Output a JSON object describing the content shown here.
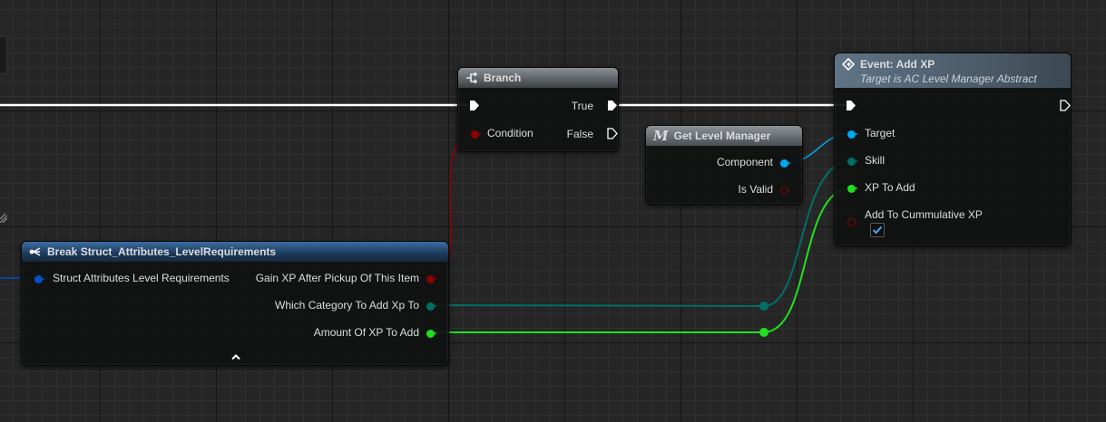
{
  "branch_node": {
    "title": "Branch",
    "condition_label": "Condition",
    "true_label": "True",
    "false_label": "False"
  },
  "get_level_manager_node": {
    "icon_letter": "M",
    "title": "Get Level Manager",
    "component_label": "Component",
    "is_valid_label": "Is Valid"
  },
  "event_node": {
    "title": "Event: Add XP",
    "subtitle": "Target is AC Level Manager Abstract",
    "target_label": "Target",
    "skill_label": "Skill",
    "xp_to_add_label": "XP To Add",
    "cumulative_label": "Add To Cummulative XP",
    "cumulative_checked": true
  },
  "break_node": {
    "title": "Break Struct_Attributes_LevelRequirements",
    "struct_input_label": "Struct Attributes Level Requirements",
    "gain_xp_label": "Gain XP After Pickup Of This Item",
    "category_label": "Which Category To Add Xp To",
    "amount_label": "Amount Of XP To Add",
    "collapse_icon": "chevron-up-icon"
  },
  "colors": {
    "bool_pin": "#8c0000",
    "object_pin": "#00a8f4",
    "byte_pin": "#006f65",
    "int_pin": "#1fe01f",
    "struct_pin": "#0050c8",
    "exec_wire": "#ffffff"
  }
}
